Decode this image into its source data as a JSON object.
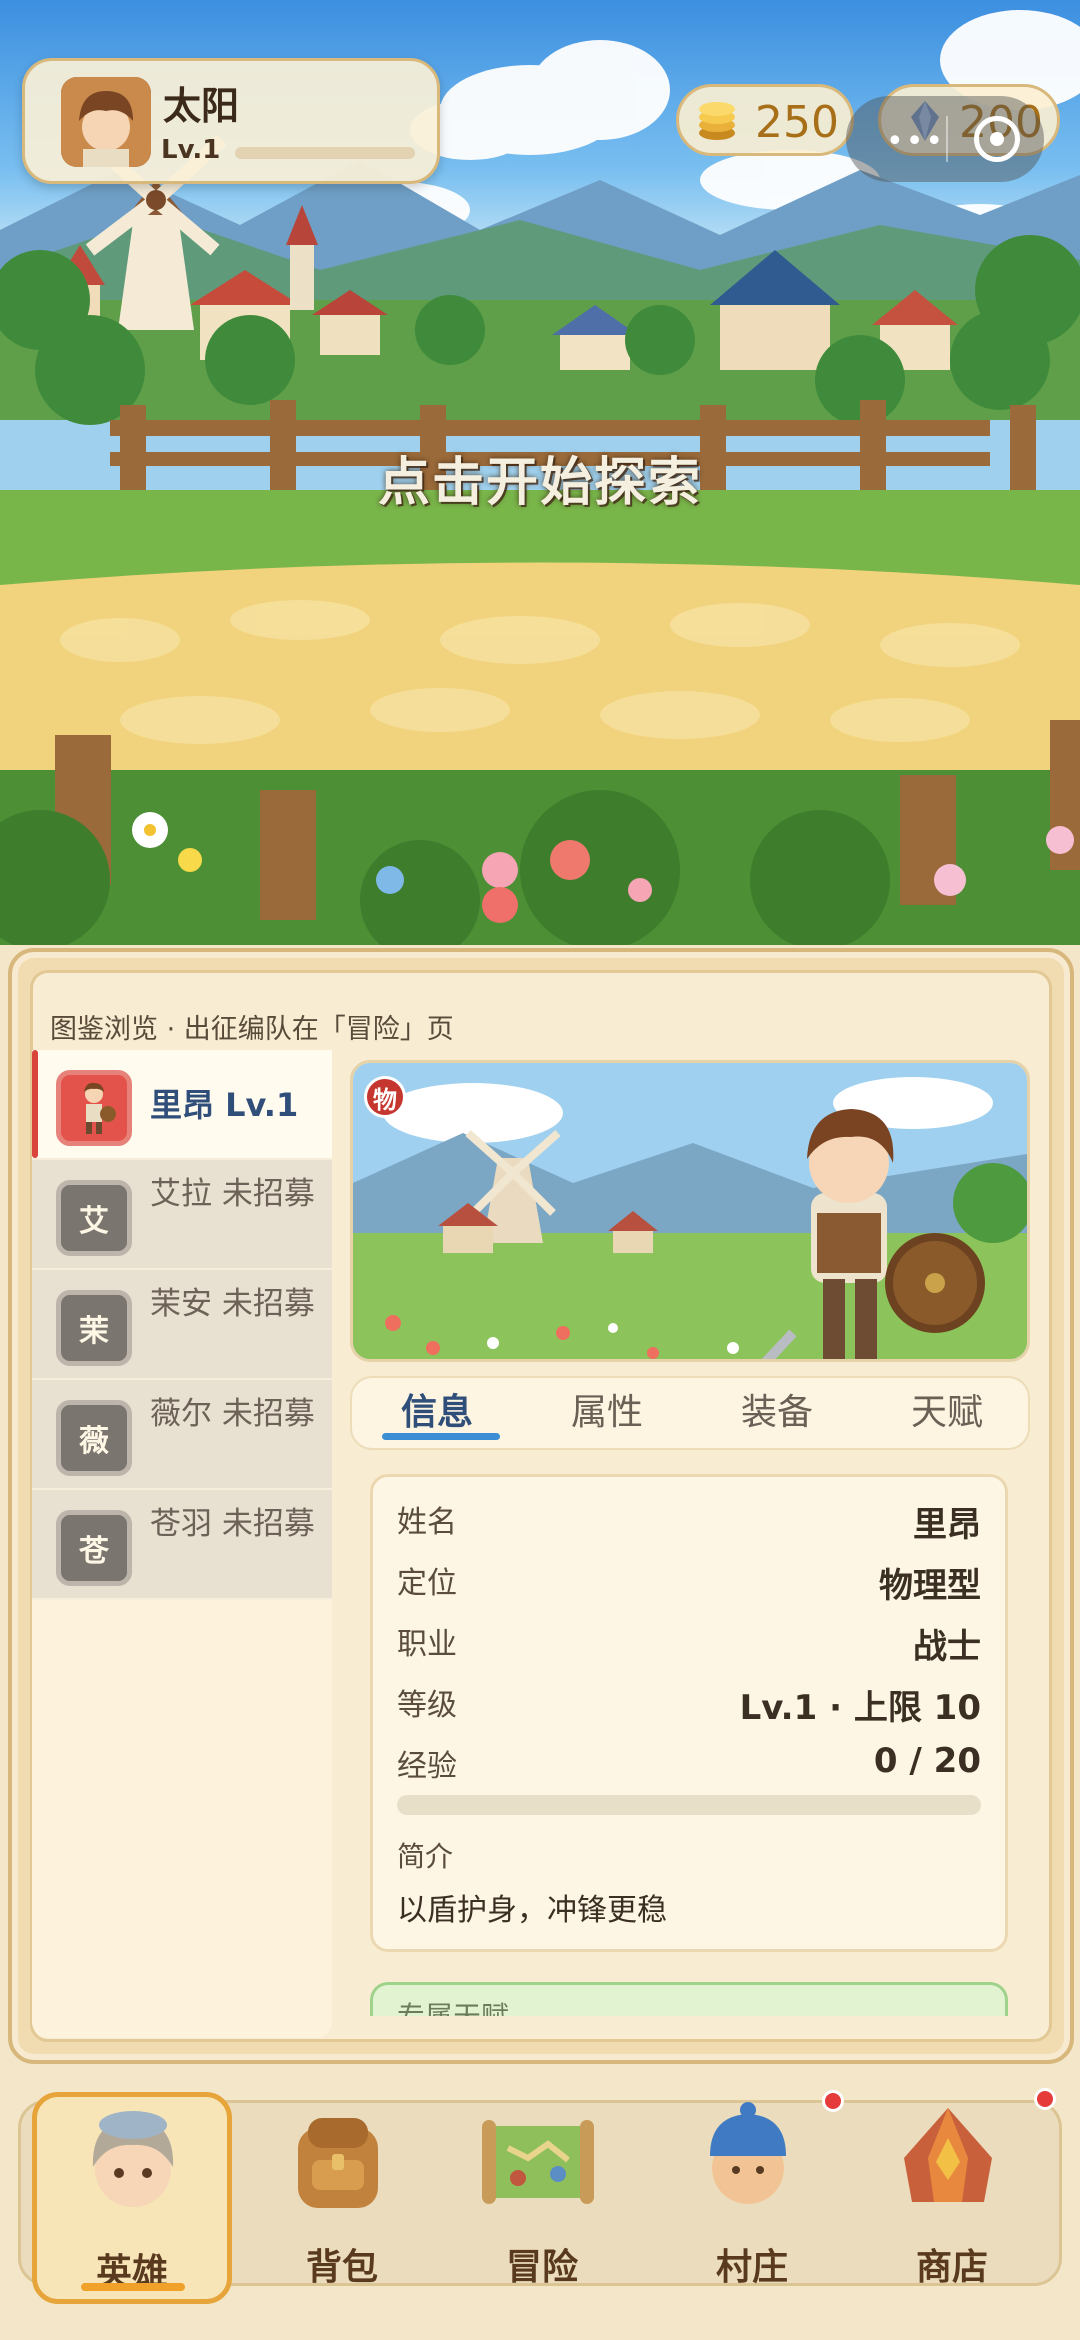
{
  "player": {
    "name": "太阳",
    "level": "Lv.1",
    "level_progress": 0.0
  },
  "currencies": {
    "coins": "250",
    "gems": "200"
  },
  "scene": {
    "prompt": "点击开始探索"
  },
  "panel": {
    "subtitle": "图鉴浏览 · 出征编队在「冒险」页",
    "heroes": [
      {
        "badge": "",
        "name": "里昂  Lv.1",
        "active": true
      },
      {
        "badge": "艾",
        "name": "艾拉  未招募",
        "active": false
      },
      {
        "badge": "茉",
        "name": "茉安  未招募",
        "active": false
      },
      {
        "badge": "薇",
        "name": "薇尔  未招募",
        "active": false
      },
      {
        "badge": "苍",
        "name": "苍羽  未招募",
        "active": false
      }
    ],
    "type_badge": "物",
    "tabs": [
      "信息",
      "属性",
      "装备",
      "天赋"
    ],
    "info": {
      "rows": [
        {
          "key": "姓名",
          "value": "里昂"
        },
        {
          "key": "定位",
          "value": "物理型"
        },
        {
          "key": "职业",
          "value": "战士"
        },
        {
          "key": "等级",
          "value": "Lv.1 · 上限 10"
        },
        {
          "key": "经验",
          "value": "0 / 20"
        }
      ],
      "exp_fraction": 0.0,
      "desc_label": "简介",
      "desc": "以盾护身，冲锋更稳"
    },
    "talent_peek": "专属天赋"
  },
  "nav": {
    "items": [
      "英雄",
      "背包",
      "冒险",
      "村庄",
      "商店"
    ],
    "active": "英雄"
  },
  "colors": {
    "accent_orange": "#e6a43a",
    "tab_blue": "#3b8ed4",
    "hero_red": "#e4534b",
    "notify_red": "#e63b3b"
  }
}
